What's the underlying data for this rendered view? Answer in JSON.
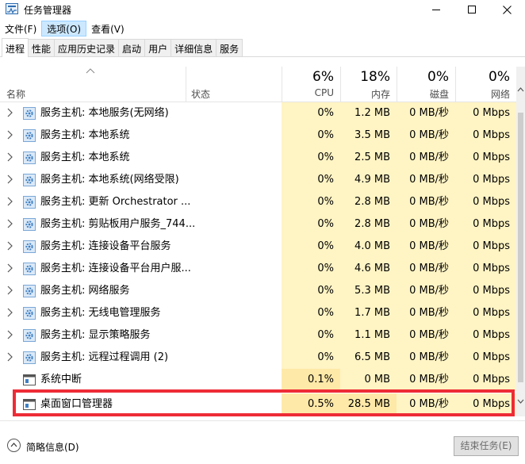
{
  "window": {
    "title": "任务管理器"
  },
  "menu": [
    {
      "label": "文件(F)",
      "active": false
    },
    {
      "label": "选项(O)",
      "active": true
    },
    {
      "label": "查看(V)",
      "active": false
    }
  ],
  "tabs": [
    {
      "label": "进程",
      "selected": true
    },
    {
      "label": "性能",
      "selected": false
    },
    {
      "label": "应用历史记录",
      "selected": false
    },
    {
      "label": "启动",
      "selected": false
    },
    {
      "label": "用户",
      "selected": false
    },
    {
      "label": "详细信息",
      "selected": false
    },
    {
      "label": "服务",
      "selected": false
    }
  ],
  "header": {
    "name": "名称",
    "status": "状态",
    "cpu": {
      "pct": "6%",
      "label": "CPU"
    },
    "mem": {
      "pct": "18%",
      "label": "内存"
    },
    "disk": {
      "pct": "0%",
      "label": "磁盘"
    },
    "net": {
      "pct": "0%",
      "label": "网络"
    }
  },
  "processes": [
    {
      "name": "服务主机: 本地服务(无网络)",
      "cpu": "0%",
      "mem": "1.2 MB",
      "disk": "0 MB/秒",
      "net": "0 Mbps",
      "expandable": true,
      "icon": "gear-icon"
    },
    {
      "name": "服务主机: 本地系统",
      "cpu": "0%",
      "mem": "3.5 MB",
      "disk": "0 MB/秒",
      "net": "0 Mbps",
      "expandable": true,
      "icon": "gear-icon"
    },
    {
      "name": "服务主机: 本地系统",
      "cpu": "0%",
      "mem": "2.5 MB",
      "disk": "0 MB/秒",
      "net": "0 Mbps",
      "expandable": true,
      "icon": "gear-icon"
    },
    {
      "name": "服务主机: 本地系统(网络受限)",
      "cpu": "0%",
      "mem": "4.9 MB",
      "disk": "0 MB/秒",
      "net": "0 Mbps",
      "expandable": true,
      "icon": "gear-icon"
    },
    {
      "name": "服务主机: 更新 Orchestrator ...",
      "cpu": "0%",
      "mem": "2.8 MB",
      "disk": "0 MB/秒",
      "net": "0 Mbps",
      "expandable": true,
      "icon": "gear-icon"
    },
    {
      "name": "服务主机: 剪贴板用户服务_744...",
      "cpu": "0%",
      "mem": "2.8 MB",
      "disk": "0 MB/秒",
      "net": "0 Mbps",
      "expandable": true,
      "icon": "gear-icon"
    },
    {
      "name": "服务主机: 连接设备平台服务",
      "cpu": "0%",
      "mem": "4.0 MB",
      "disk": "0 MB/秒",
      "net": "0 Mbps",
      "expandable": true,
      "icon": "gear-icon"
    },
    {
      "name": "服务主机: 连接设备平台用户服...",
      "cpu": "0%",
      "mem": "4.6 MB",
      "disk": "0 MB/秒",
      "net": "0 Mbps",
      "expandable": true,
      "icon": "gear-icon"
    },
    {
      "name": "服务主机: 网络服务",
      "cpu": "0%",
      "mem": "5.3 MB",
      "disk": "0 MB/秒",
      "net": "0 Mbps",
      "expandable": true,
      "icon": "gear-icon"
    },
    {
      "name": "服务主机: 无线电管理服务",
      "cpu": "0%",
      "mem": "1.7 MB",
      "disk": "0 MB/秒",
      "net": "0 Mbps",
      "expandable": true,
      "icon": "gear-icon"
    },
    {
      "name": "服务主机: 显示策略服务",
      "cpu": "0%",
      "mem": "1.1 MB",
      "disk": "0 MB/秒",
      "net": "0 Mbps",
      "expandable": true,
      "icon": "gear-icon"
    },
    {
      "name": "服务主机: 远程过程调用 (2)",
      "cpu": "0%",
      "mem": "6.5 MB",
      "disk": "0 MB/秒",
      "net": "0 Mbps",
      "expandable": true,
      "icon": "gear-icon"
    },
    {
      "name": "系统中断",
      "cpu": "0.1%",
      "mem": "0 MB",
      "disk": "0 MB/秒",
      "net": "0 Mbps",
      "expandable": false,
      "icon": "window-icon"
    },
    {
      "name": "桌面窗口管理器",
      "cpu": "0.5%",
      "mem": "28.5 MB",
      "disk": "0 MB/秒",
      "net": "0 Mbps",
      "expandable": false,
      "icon": "window-icon"
    }
  ],
  "footer": {
    "details_label": "简略信息(D)",
    "end_task_label": "结束任务(E)"
  },
  "colors": {
    "cell_bg": "#fff4c4",
    "cell_bg_hi": "#ffe9a8",
    "highlight": "#ee2b36",
    "menu_active": "#cce8ff"
  }
}
